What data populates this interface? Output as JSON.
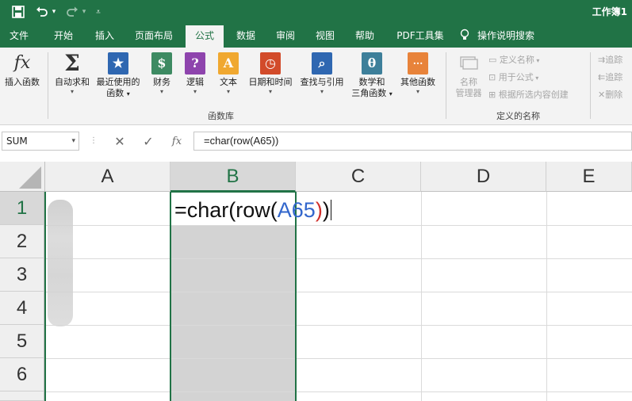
{
  "title_bar": {
    "document_title": "工作簿1",
    "save_icon": "save-icon",
    "undo_icon": "undo-icon",
    "redo_icon": "redo-icon",
    "customize_icon": "customize-qat-icon"
  },
  "tabs": [
    {
      "label": "文件"
    },
    {
      "label": "开始"
    },
    {
      "label": "插入"
    },
    {
      "label": "页面布局"
    },
    {
      "label": "公式"
    },
    {
      "label": "数据"
    },
    {
      "label": "审阅"
    },
    {
      "label": "视图"
    },
    {
      "label": "帮助"
    },
    {
      "label": "PDF工具集"
    }
  ],
  "tell_me": {
    "label": "操作说明搜索",
    "icon": "lightbulb-icon"
  },
  "ribbon": {
    "function_library": {
      "group_label": "函数库",
      "insert_function": {
        "label": "插入函数",
        "icon": "fx"
      },
      "autosum": {
        "label_line1": "自动求和",
        "icon": "Σ"
      },
      "recently_used": {
        "label_line1": "最近使用的",
        "label_line2": "函数",
        "icon": "★"
      },
      "financial": {
        "label_line1": "财务",
        "icon": "$"
      },
      "logical": {
        "label_line1": "逻辑",
        "icon": "?"
      },
      "text": {
        "label_line1": "文本",
        "icon": "A"
      },
      "date_time": {
        "label_line1": "日期和时间",
        "icon": "◷"
      },
      "lookup": {
        "label_line1": "查找与引用",
        "icon": "⌕"
      },
      "math_trig": {
        "label_line1": "数学和",
        "label_line2": "三角函数",
        "icon": "θ"
      },
      "more_functions": {
        "label_line1": "其他函数",
        "icon": "···"
      }
    },
    "defined_names": {
      "group_label": "定义的名称",
      "name_manager_line1": "名称",
      "name_manager_line2": "管理器",
      "define_name": "定义名称",
      "use_in_formula": "用于公式",
      "create_from_selection": "根据所选内容创建"
    },
    "formula_auditing": {
      "trace_precedents": "追踪",
      "trace_dependents": "追踪",
      "remove_arrows": "删除"
    }
  },
  "formula_bar": {
    "name_box": "SUM",
    "formula": "=char(row(A65))",
    "cancel_symbol": "✕",
    "enter_symbol": "✓",
    "fx_symbol": "fx"
  },
  "grid": {
    "columns": [
      "A",
      "B",
      "C",
      "D",
      "E"
    ],
    "rows": [
      "1",
      "2",
      "3",
      "4",
      "5",
      "6"
    ],
    "active_cell": "B1",
    "cell_b1": {
      "part_prefix": "=char(row(",
      "part_ref": "A65",
      "part_paren_red": ")",
      "part_paren_last": ")",
      "ref_color": "#3266cc",
      "paren_color": "#d0302c"
    }
  },
  "colors": {
    "accent": "#217346",
    "ribbon_bg": "#f3f3f3",
    "selected_column": "#d3d3d3"
  }
}
